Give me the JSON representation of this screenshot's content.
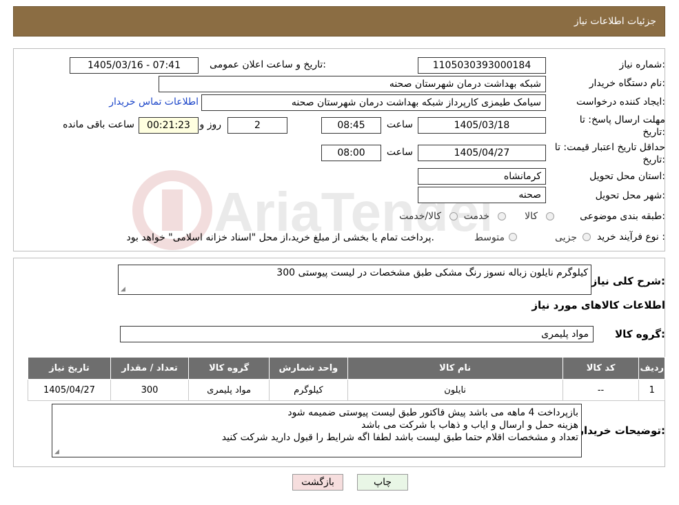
{
  "header": {
    "title": "جزئیات اطلاعات نیاز"
  },
  "form": {
    "need_number_label": "شماره نیاز:",
    "need_number": "1105030393000184",
    "announce_label": "تاریخ و ساعت اعلان عمومی:",
    "announce_value": "1405/03/16 - 07:41",
    "buyer_org_label": "نام دستگاه خریدار:",
    "buyer_org": "شبکه بهداشت درمان شهرستان صحنه",
    "creator_label": "ایجاد کننده درخواست:",
    "creator": "سیامک طیمزی کارپرداز شبکه بهداشت درمان شهرستان صحنه",
    "contact_link": "اطلاعات تماس خریدار",
    "deadline_label": "مهلت ارسال پاسخ: تا تاریخ:",
    "deadline_date": "1405/03/18",
    "time_label": "ساعت",
    "deadline_time": "08:45",
    "days_value": "2",
    "days_label": "روز و",
    "remaining_time": "00:21:23",
    "remaining_label": "ساعت باقی مانده",
    "validity_label": "حداقل تاریخ اعتبار قیمت: تا تاریخ:",
    "validity_date": "1405/04/27",
    "validity_time": "08:00",
    "province_label": "استان محل تحویل:",
    "province": "کرمانشاه",
    "city_label": "شهر محل تحویل:",
    "city": "صحنه",
    "category_label": "طبقه بندی موضوعی:",
    "category_options": [
      "کالا",
      "خدمت",
      "کالا/خدمت"
    ],
    "process_label": "نوع فرآیند خرید :",
    "process_options": [
      "جزیی",
      "متوسط"
    ],
    "process_note": "پرداخت تمام یا بخشی از مبلغ خرید،از محل \"اسناد خزانه اسلامی\" خواهد بود."
  },
  "description": {
    "label": "شرح کلی نیاز:",
    "text": "300 کیلوگرم نایلون زباله نسوز رنگ مشکی طبق مشخصات در لیست پیوستی"
  },
  "goods": {
    "section_title": "اطلاعات کالاهای مورد نیاز",
    "group_label": "گروه کالا:",
    "group_value": "مواد پلیمری",
    "columns": [
      "ردیف",
      "کد کالا",
      "نام کالا",
      "واحد شمارش",
      "گروه کالا",
      "تعداد / مقدار",
      "تاریخ نیاز"
    ],
    "rows": [
      [
        "1",
        "--",
        "نایلون",
        "کیلوگرم",
        "مواد پلیمری",
        "300",
        "1405/04/27"
      ]
    ]
  },
  "buyer_notes": {
    "label": "توضیحات خریدار:",
    "lines": [
      "بازپرداخت 4 ماهه می باشد پیش فاکتور طبق لیست پیوستی ضمیمه شود",
      "هزینه حمل و ارسال و ایاب و ذهاب با شرکت می باشد",
      "تعداد و مشخصات اقلام حتما طبق لیست باشد  لطفا اگه شرایط را قبول دارید شرکت کنید"
    ]
  },
  "buttons": {
    "print": "چاپ",
    "back": "بازگشت"
  },
  "watermark": {
    "text": "AriaTender.neT"
  },
  "colors": {
    "header_bg": "#8b6d43",
    "table_header_bg": "#6e6e6e",
    "link": "#1a44c8",
    "back_button_bg": "#f6dede",
    "print_button_bg": "#e9f6e6"
  }
}
